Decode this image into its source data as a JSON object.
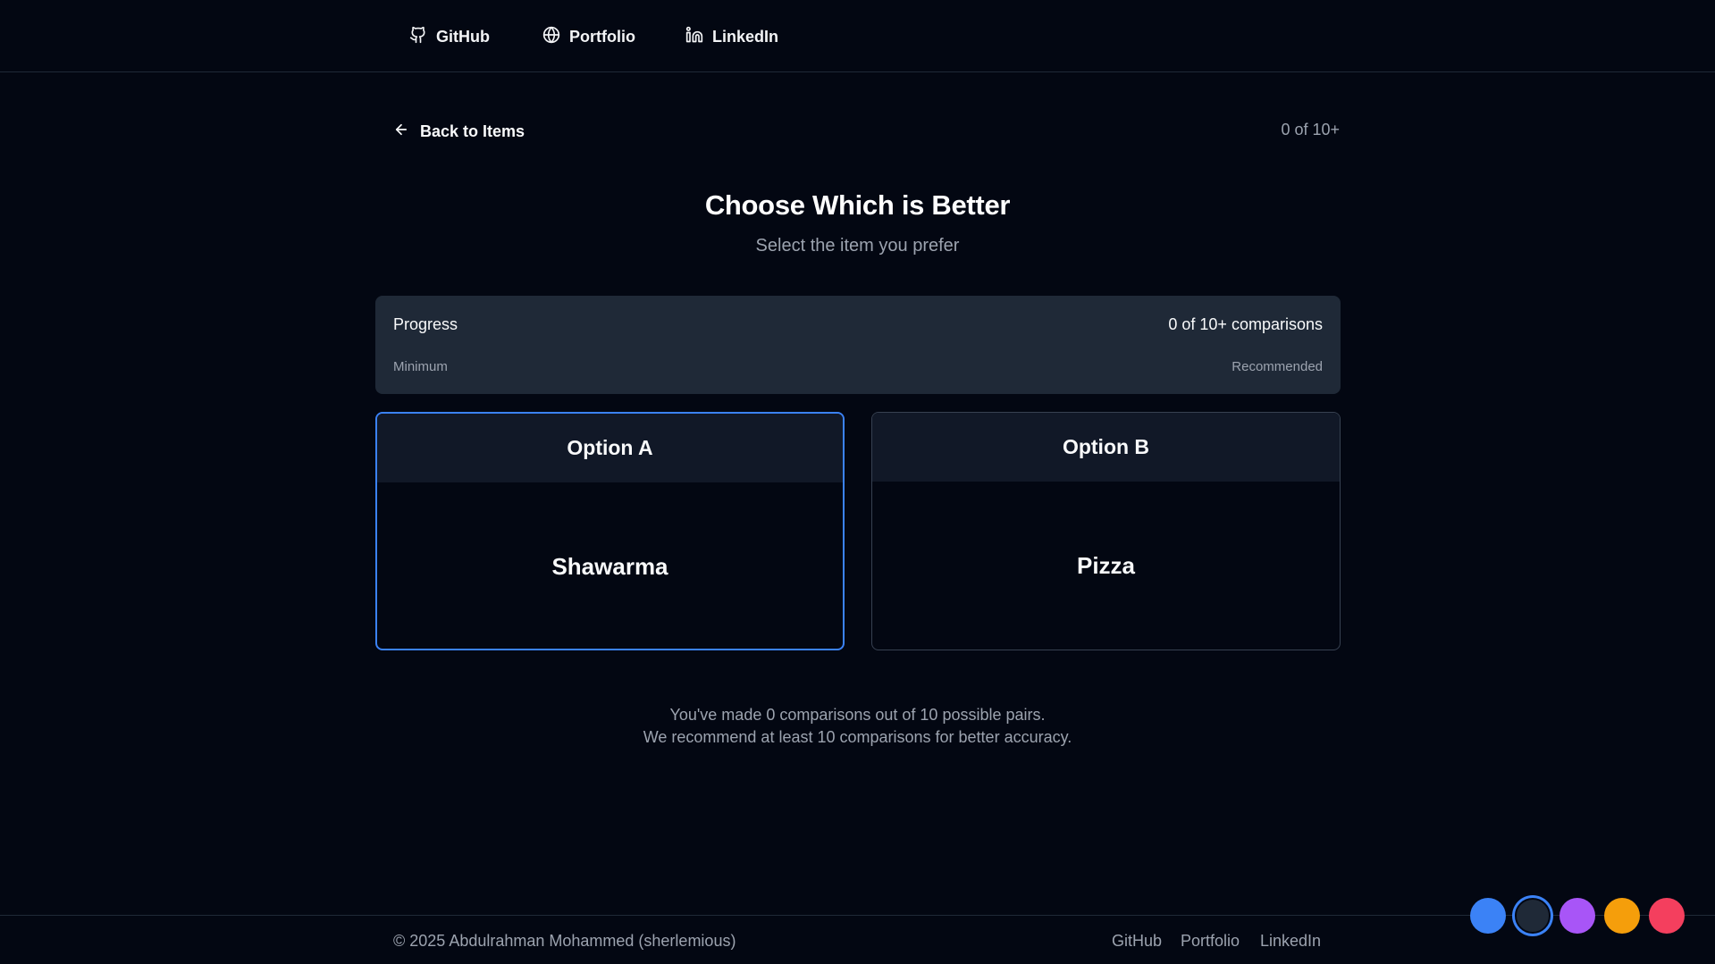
{
  "nav": {
    "github": "GitHub",
    "portfolio": "Portfolio",
    "linkedin": "LinkedIn"
  },
  "header": {
    "back_label": "Back to Items",
    "counter": "0 of 10+"
  },
  "main": {
    "title": "Choose Which is Better",
    "subtitle": "Select the item you prefer"
  },
  "progress": {
    "label": "Progress",
    "count": "0 of 10+ comparisons",
    "min_label": "Minimum",
    "rec_label": "Recommended",
    "fraction": 0
  },
  "options": {
    "a": {
      "header": "Option A",
      "item": "Shawarma"
    },
    "b": {
      "header": "Option B",
      "item": "Pizza"
    }
  },
  "note": {
    "line1": "You've made 0 comparisons out of 10 possible pairs.",
    "line2": "We recommend at least 10 comparisons for better accuracy."
  },
  "footer": {
    "copyright": "© 2025 Abdulrahman Mohammed (sherlemious)",
    "github": "GitHub",
    "portfolio": "Portfolio",
    "linkedin": "LinkedIn"
  },
  "theme_swatches": [
    {
      "name": "blue",
      "color": "#3b82f6"
    },
    {
      "name": "dark",
      "color": "#1f2937"
    },
    {
      "name": "purple",
      "color": "#a855f7"
    },
    {
      "name": "amber",
      "color": "#f59e0b"
    },
    {
      "name": "rose",
      "color": "#f43f5e"
    }
  ],
  "colors": {
    "background": "#030712",
    "accent": "#3b82f6",
    "panel": "#1f2937"
  }
}
